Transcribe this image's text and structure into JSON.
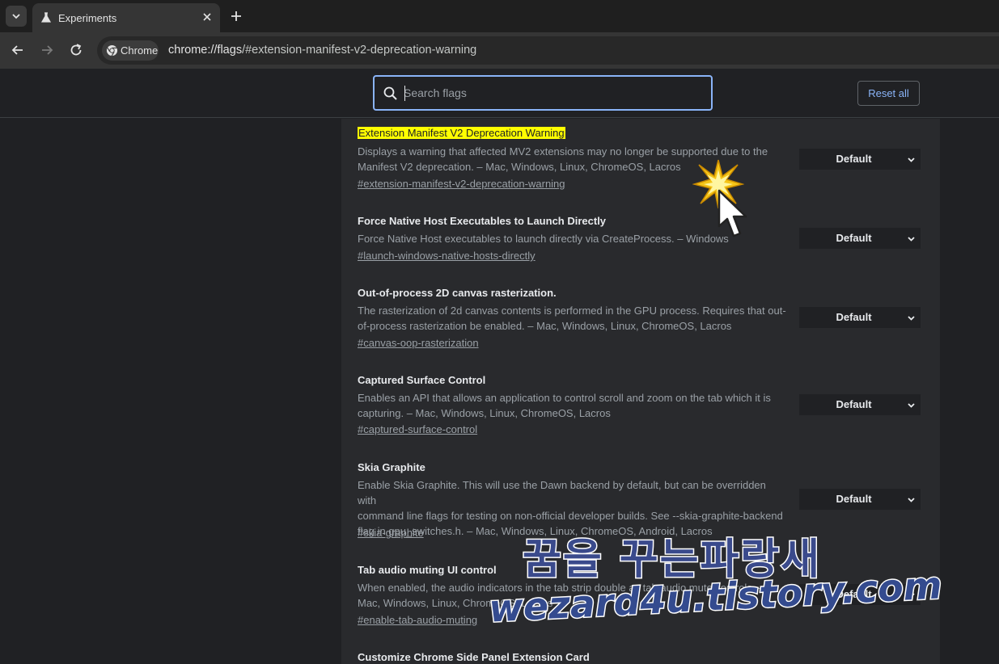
{
  "tab": {
    "title": "Experiments"
  },
  "omnibox": {
    "chip_label": "Chrome",
    "url_host": "chrome://flags",
    "url_path": "/#extension-manifest-v2-deprecation-warning"
  },
  "search": {
    "placeholder": "Search flags"
  },
  "reset_label": "Reset all",
  "flags": [
    {
      "name": "Extension Manifest V2 Deprecation Warning",
      "desc_lines": [
        "Displays a warning that affected MV2 extensions may no longer be supported due to the",
        "Manifest V2 deprecation. – Mac, Windows, Linux, ChromeOS, Lacros"
      ],
      "link": "#extension-manifest-v2-deprecation-warning",
      "value": "Default",
      "highlighted": true
    },
    {
      "name": "Force Native Host Executables to Launch Directly",
      "desc_lines": [
        "Force Native Host executables to launch directly via CreateProcess. – Windows"
      ],
      "link": "#launch-windows-native-hosts-directly",
      "value": "Default"
    },
    {
      "name": "Out-of-process 2D canvas rasterization.",
      "desc_lines": [
        "The rasterization of 2d canvas contents is performed in the GPU process. Requires that out-",
        "of-process rasterization be enabled. – Mac, Windows, Linux, ChromeOS, Lacros"
      ],
      "link": "#canvas-oop-rasterization",
      "value": "Default"
    },
    {
      "name": "Captured Surface Control",
      "desc_lines": [
        "Enables an API that allows an application to control scroll and zoom on the tab which it is",
        "capturing. – Mac, Windows, Linux, ChromeOS, Lacros"
      ],
      "link": "#captured-surface-control",
      "value": "Default"
    },
    {
      "name": "Skia Graphite",
      "desc_lines": [
        "Enable Skia Graphite. This will use the Dawn backend by default, but can be overridden with",
        "command line flags for testing on non-official developer builds. See --skia-graphite-backend",
        "flag in gpu_switches.h. – Mac, Windows, Linux, ChromeOS, Android, Lacros"
      ],
      "link": "#skia-graphite",
      "value": "Default"
    },
    {
      "name": "Tab audio muting UI control",
      "desc_lines": [
        "When enabled, the audio indicators in the tab strip double as tab audio mute controls. –",
        "Mac, Windows, Linux, ChromeOS, Lacros"
      ],
      "link": "#enable-tab-audio-muting",
      "value": "Default"
    },
    {
      "name": "Customize Chrome Side Panel Extension Card"
    }
  ],
  "watermark": {
    "korean": "꿈을 꾸는파랑새",
    "url": "wezard4u.tistory.com"
  },
  "colors": {
    "accent": "#8ab4f8",
    "highlight": "#ffff00",
    "page_bg": "#202124",
    "card_bg": "#292a2d"
  },
  "icons": [
    "tab-search-icon",
    "flask-icon",
    "close-icon",
    "plus-icon",
    "back-arrow-icon",
    "forward-arrow-icon",
    "reload-icon",
    "chrome-logo-icon",
    "search-icon",
    "chevron-down-icon",
    "mouse-cursor-icon",
    "click-spark-icon"
  ]
}
